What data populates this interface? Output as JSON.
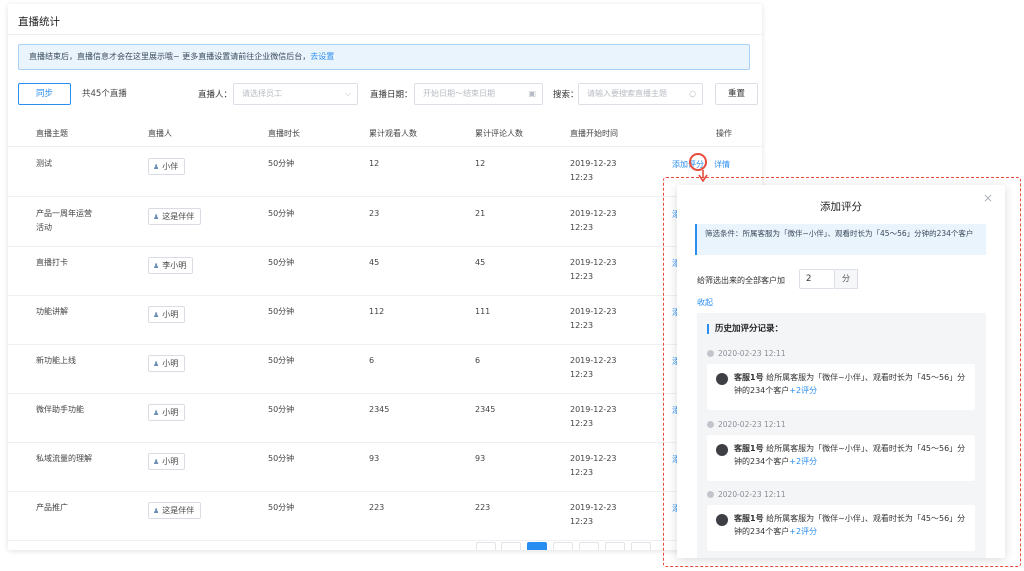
{
  "page": {
    "title": "直播统计"
  },
  "info": {
    "text": "直播结束后，直播信息才会在这里展示哦~ 更多直播设置请前往企业微信后台，",
    "link": "去设置"
  },
  "toolbar": {
    "sync": "同步",
    "total": "共45个直播",
    "anchor_label": "直播人：",
    "anchor_placeholder": "请选择员工",
    "date_label": "直播日期：",
    "date_placeholder": "开始日期～结束日期",
    "search_label": "搜索：",
    "search_placeholder": "请输入要搜索直播主题",
    "reset": "重置"
  },
  "table": {
    "headers": [
      "直播主题",
      "直播人",
      "直播时长",
      "累计观看人数",
      "累计评论人数",
      "直播开始时间",
      "操作"
    ],
    "rows": [
      {
        "topic": "测试",
        "anchor": "小伴",
        "duration": "50分钟",
        "viewers": "12",
        "comments": "12",
        "date": "2019-12-23",
        "time": "12:23"
      },
      {
        "topic": "产品一周年运营活动",
        "anchor": "这是伴伴",
        "duration": "50分钟",
        "viewers": "23",
        "comments": "21",
        "date": "2019-12-23",
        "time": "12:23"
      },
      {
        "topic": "直播打卡",
        "anchor": "李小明",
        "duration": "50分钟",
        "viewers": "45",
        "comments": "45",
        "date": "2019-12-23",
        "time": "12:23"
      },
      {
        "topic": "功能讲解",
        "anchor": "小明",
        "duration": "50分钟",
        "viewers": "112",
        "comments": "111",
        "date": "2019-12-23",
        "time": "12:23"
      },
      {
        "topic": "新功能上线",
        "anchor": "小明",
        "duration": "50分钟",
        "viewers": "6",
        "comments": "6",
        "date": "2019-12-23",
        "time": "12:23"
      },
      {
        "topic": "微伴助手功能",
        "anchor": "小明",
        "duration": "50分钟",
        "viewers": "2345",
        "comments": "2345",
        "date": "2019-12-23",
        "time": "12:23"
      },
      {
        "topic": "私域流量的理解",
        "anchor": "小明",
        "duration": "50分钟",
        "viewers": "93",
        "comments": "93",
        "date": "2019-12-23",
        "time": "12:23"
      },
      {
        "topic": "产品推广",
        "anchor": "这是伴伴",
        "duration": "50分钟",
        "viewers": "223",
        "comments": "223",
        "date": "2019-12-23",
        "time": "12:23"
      }
    ],
    "actions": {
      "add_score": "添加评分",
      "detail": "详情",
      "truncated": "添"
    }
  },
  "modal": {
    "title": "添加评分",
    "filter": "筛选条件：所属客服为「微伴~小伴」、观看时长为「45～56」分钟的234个客户",
    "add_label": "给筛选出来的全部客户加",
    "add_value": "2",
    "unit": "分",
    "collapse": "收起",
    "history_title": "历史加评分记录：",
    "records": [
      {
        "time": "2020-02-23 12:11",
        "author": "客服1号",
        "text": "给所属客服为「微伴~小伴」、观看时长为「45～56」分钟的234个客户",
        "score": "+2评分"
      },
      {
        "time": "2020-02-23 12:11",
        "author": "客服1号",
        "text": "给所属客服为「微伴~小伴」、观看时长为「45～56」分钟的234个客户",
        "score": "+2评分"
      },
      {
        "time": "2020-02-23 12:11",
        "author": "客服1号",
        "text": "给所属客服为「微伴~小伴」、观看时长为「45～56」分钟的234个客户",
        "score": "+2评分"
      }
    ]
  },
  "icons": {
    "close": "close-icon",
    "calendar": "calendar-icon",
    "search": "search-icon",
    "chevron": "chevron-down-icon",
    "person": "person-icon",
    "clock": "clock-icon"
  },
  "colors": {
    "primary": "#2a8df0",
    "highlight": "#e84c3d",
    "info_bg": "#eaf4fd"
  }
}
